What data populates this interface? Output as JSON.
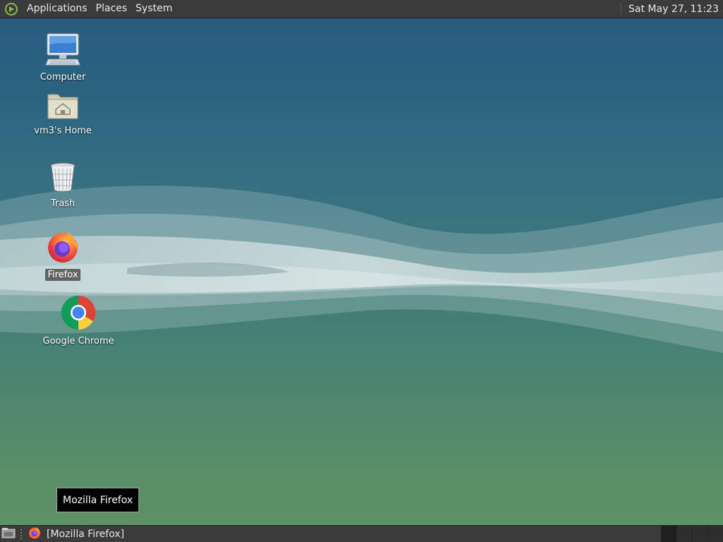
{
  "top_panel": {
    "menus": [
      "Applications",
      "Places",
      "System"
    ],
    "clock": "Sat May 27, 11:23"
  },
  "desktop": {
    "icons": [
      {
        "label": "Computer",
        "icon": "computer-icon"
      },
      {
        "label": "vm3's Home",
        "icon": "home-folder-icon"
      },
      {
        "label": "Trash",
        "icon": "trash-icon"
      },
      {
        "label": "Firefox",
        "icon": "firefox-icon",
        "selected": true
      },
      {
        "label": "Google Chrome",
        "icon": "chrome-icon"
      }
    ]
  },
  "tooltip": {
    "text": "Mozilla Firefox"
  },
  "bottom_panel": {
    "tasks": [
      {
        "label": "[Mozilla Firefox]",
        "icon": "firefox-icon"
      }
    ],
    "workspaces": 4
  },
  "colors": {
    "panel": "#3b3b3b",
    "wallpaper_top": "#285a7e",
    "wallpaper_bottom": "#5f9262"
  }
}
